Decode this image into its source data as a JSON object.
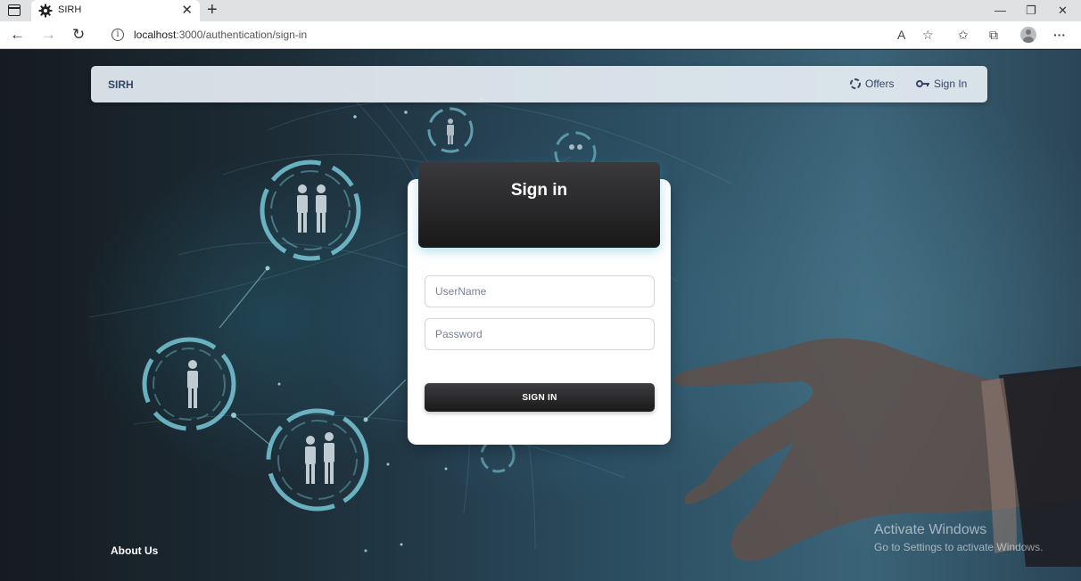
{
  "browser": {
    "tab_title": "SIRH",
    "url_host": "localhost",
    "url_path": ":3000/authentication/sign-in",
    "icons": {
      "tab_actions": "tab-actions-icon",
      "favicon": "gear-icon",
      "close": "close-icon",
      "new_tab": "plus-icon",
      "back": "back-arrow-icon",
      "forward": "forward-arrow-icon",
      "refresh": "refresh-icon",
      "info": "info-icon",
      "read_aloud": "read-aloud-icon",
      "add_favorite": "add-favorite-icon",
      "favorites": "favorites-icon",
      "collections": "collections-icon",
      "profile": "profile-avatar",
      "more": "more-icon"
    },
    "tab_close_glyph": "✕",
    "new_tab_glyph": "+",
    "minimize_glyph": "—",
    "restore_glyph": "❐",
    "close_glyph": "✕",
    "back_glyph": "←",
    "forward_glyph": "→",
    "refresh_glyph": "↻",
    "info_glyph": "i",
    "read_aloud_glyph": "A",
    "add_favorite_glyph": "☆",
    "favorites_glyph": "✩",
    "collections_glyph": "⧉",
    "more_glyph": "···"
  },
  "navbar": {
    "brand": "SIRH",
    "links": [
      {
        "label": "Offers",
        "icon": "spinner-icon"
      },
      {
        "label": "Sign In",
        "icon": "key-icon"
      }
    ]
  },
  "signin_card": {
    "title": "Sign in",
    "username_placeholder": "UserName",
    "password_placeholder": "Password",
    "submit_label": "SIGN IN"
  },
  "footer": {
    "about_label": "About Us"
  },
  "watermark": {
    "title": "Activate Windows",
    "subtitle": "Go to Settings to activate Windows."
  },
  "colors": {
    "navbar_text": "#344767",
    "card_header": "#191919",
    "accent_glow": "#4fb3c8"
  }
}
